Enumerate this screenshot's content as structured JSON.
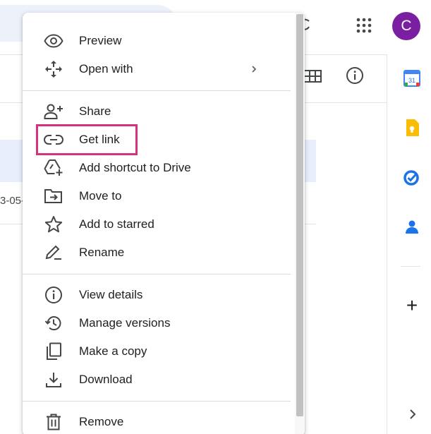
{
  "header": {
    "avatar_letter": "C",
    "avatar_color": "#7b1fa2",
    "apps_icon": "apps-grid-icon"
  },
  "file_list": {
    "date_fragment": "3-05-"
  },
  "side_panel": {
    "apps": [
      "calendar-icon",
      "keep-icon",
      "tasks-icon",
      "contacts-icon"
    ],
    "calendar_day": "31",
    "add_icon": "plus-icon"
  },
  "context_menu": {
    "items": [
      {
        "label": "Preview",
        "icon": "eye-icon"
      },
      {
        "label": "Open with",
        "icon": "open-with-icon",
        "submenu": true
      },
      {
        "label": "Share",
        "icon": "person-add-icon"
      },
      {
        "label": "Get link",
        "icon": "link-icon",
        "highlighted": true
      },
      {
        "label": "Add shortcut to Drive",
        "icon": "add-shortcut-icon"
      },
      {
        "label": "Move to",
        "icon": "move-to-folder-icon"
      },
      {
        "label": "Add to starred",
        "icon": "star-icon"
      },
      {
        "label": "Rename",
        "icon": "pencil-icon"
      },
      {
        "label": "View details",
        "icon": "info-icon"
      },
      {
        "label": "Manage versions",
        "icon": "history-icon"
      },
      {
        "label": "Make a copy",
        "icon": "copy-icon"
      },
      {
        "label": "Download",
        "icon": "download-icon"
      },
      {
        "label": "Remove",
        "icon": "trash-icon"
      }
    ]
  },
  "colors": {
    "highlight_border": "#d6317b",
    "selected_row": "#e8eefb",
    "icon_gray": "#444746"
  }
}
